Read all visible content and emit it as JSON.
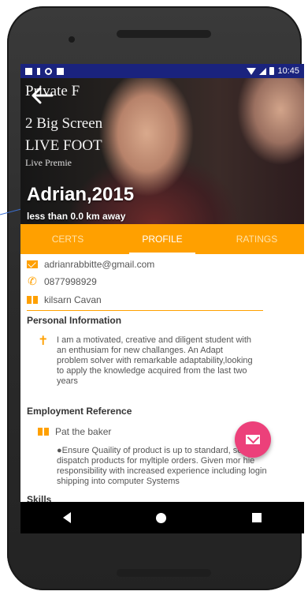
{
  "status_bar": {
    "time": "10:45"
  },
  "hero": {
    "poster_lines": [
      "Private F",
      "2 Big Screen",
      "LIVE FOOT",
      "Live Premie"
    ],
    "name": "Adrian,2015",
    "distance": "less than 0.0 km away"
  },
  "tabs": [
    {
      "label": "CERTS",
      "active": false
    },
    {
      "label": "PROFILE",
      "active": true
    },
    {
      "label": "RATINGS",
      "active": false
    }
  ],
  "contact": {
    "email": "adrianrabbitte@gmail.com",
    "phone": "0877998929",
    "location": "kilsarn Cavan"
  },
  "sections": {
    "personal_title": "Personal Information",
    "personal_text": "I am a motivated, creative and diligent student with an enthusiam  for new challanges. An Adapt problem solver with remarkable adaptability,looking to apply the knowledge acquired from the last two years",
    "employment_title": "Employment Reference",
    "employer": "Pat the baker",
    "employment_text": "●Ensure Quaility of product is up to standard, sort and dispatch products for myltiple orders. Given mor hie responsibility with increased experience including login shipping into computer Systems",
    "skills_title": "Skills"
  },
  "colors": {
    "accent": "#ffa000",
    "fab": "#ec407a",
    "status_bar": "#1a237e"
  }
}
